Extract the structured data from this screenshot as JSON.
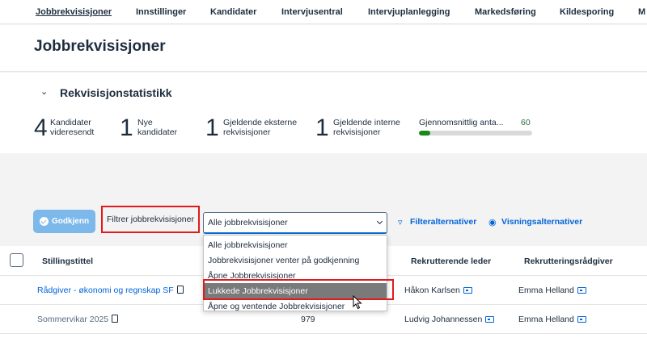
{
  "nav": {
    "items": [
      {
        "label": "Jobbrekvisisjoner",
        "active": true
      },
      {
        "label": "Innstillinger"
      },
      {
        "label": "Kandidater"
      },
      {
        "label": "Intervjusentral"
      },
      {
        "label": "Intervjuplanlegging"
      },
      {
        "label": "Markedsføring"
      },
      {
        "label": "Kildesporing"
      },
      {
        "label": "M"
      }
    ]
  },
  "page": {
    "title": "Jobbrekvisisjoner"
  },
  "stats": {
    "title": "Rekvisisjonstatistikk",
    "toggle_icon": "chevron-down-icon",
    "items": [
      {
        "value": "4",
        "label_line1": "Kandidater",
        "label_line2": "videresendt"
      },
      {
        "value": "1",
        "label_line1": "Nye",
        "label_line2": "kandidater"
      },
      {
        "value": "1",
        "label_line1": "Gjeldende eksterne",
        "label_line2": "rekvisisjoner"
      },
      {
        "value": "1",
        "label_line1": "Gjeldende interne",
        "label_line2": "rekvisisjoner"
      }
    ],
    "average": {
      "label": "Gjennomsnittlig anta...",
      "value": "60",
      "progress_fraction": 0.1,
      "color": "#188918"
    }
  },
  "toolbar": {
    "approve_label": "Godkjenn",
    "filter_label": "Filtrer jobbrekvisisjoner",
    "select_value": "Alle jobbrekvisisjoner",
    "filter_options_label": "Filteralternativer",
    "view_options_label": "Visningsalternativer"
  },
  "dropdown": {
    "options": [
      {
        "label": "Alle jobbrekvisisjoner"
      },
      {
        "label": "Jobbrekvisisjoner venter på godkjenning"
      },
      {
        "label": "Åpne Jobbrekvisisjoner"
      },
      {
        "label": "Lukkede Jobbrekvisisjoner",
        "selected": true
      },
      {
        "label": "Åpne og ventende Jobbrekvisisjoner"
      }
    ]
  },
  "table": {
    "headers": {
      "title": "Stillingstittel",
      "manager": "Rekrutterende leder",
      "advisor": "Rekrutteringsrådgiver"
    },
    "rows": [
      {
        "title": "Rådgiver - økonomi og regnskap SF",
        "id": "",
        "manager": "Håkon Karlsen",
        "advisor": "Emma Helland",
        "is_link": true
      },
      {
        "title": "Sommervikar 2025",
        "id": "979",
        "manager": "Ludvig Johannessen",
        "advisor": "Emma Helland",
        "is_link": false
      }
    ]
  }
}
